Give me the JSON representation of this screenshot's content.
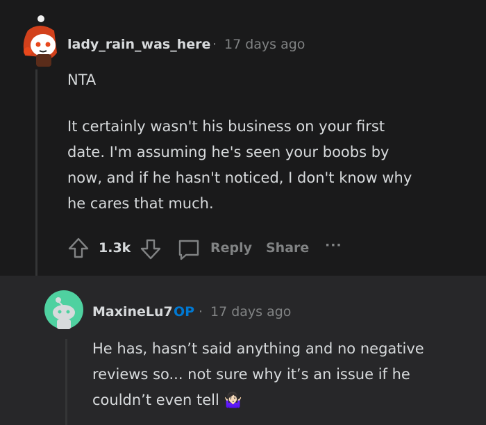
{
  "comment": {
    "author": "lady_rain_was_here",
    "separator": "·",
    "age": "17 days ago",
    "verdict": "NTA",
    "body_lines": [
      "It certainly wasn't his business on your first",
      "date. I'm assuming he's seen your boobs by",
      "now, and if he hasn't noticed, I don't know why",
      "he cares that much."
    ],
    "score": "1.3k",
    "reply_label": "Reply",
    "share_label": "Share",
    "more_label": "···"
  },
  "reply": {
    "author": "MaxineLu7",
    "op_badge": "OP",
    "separator": "·",
    "age": "17 days ago",
    "body_lines": [
      "He has, hasn’t said anything and no negative",
      "reviews so... not sure why it’s an issue if he",
      "couldn’t even tell"
    ],
    "emoji": "🤷🏻‍♀️"
  },
  "icons": {
    "upvote": "upvote-arrow-icon",
    "downvote": "downvote-arrow-icon",
    "comment": "comment-bubble-icon",
    "avatar1": "snoo-avatar-red-hair",
    "avatar2": "snoo-avatar-default-teal"
  },
  "colors": {
    "background": "#1a1a1b",
    "reply_background": "#272729",
    "text": "#d7dadc",
    "meta": "#818384",
    "op": "#0079d3",
    "avatar2_bg": "#4fd1a0"
  }
}
